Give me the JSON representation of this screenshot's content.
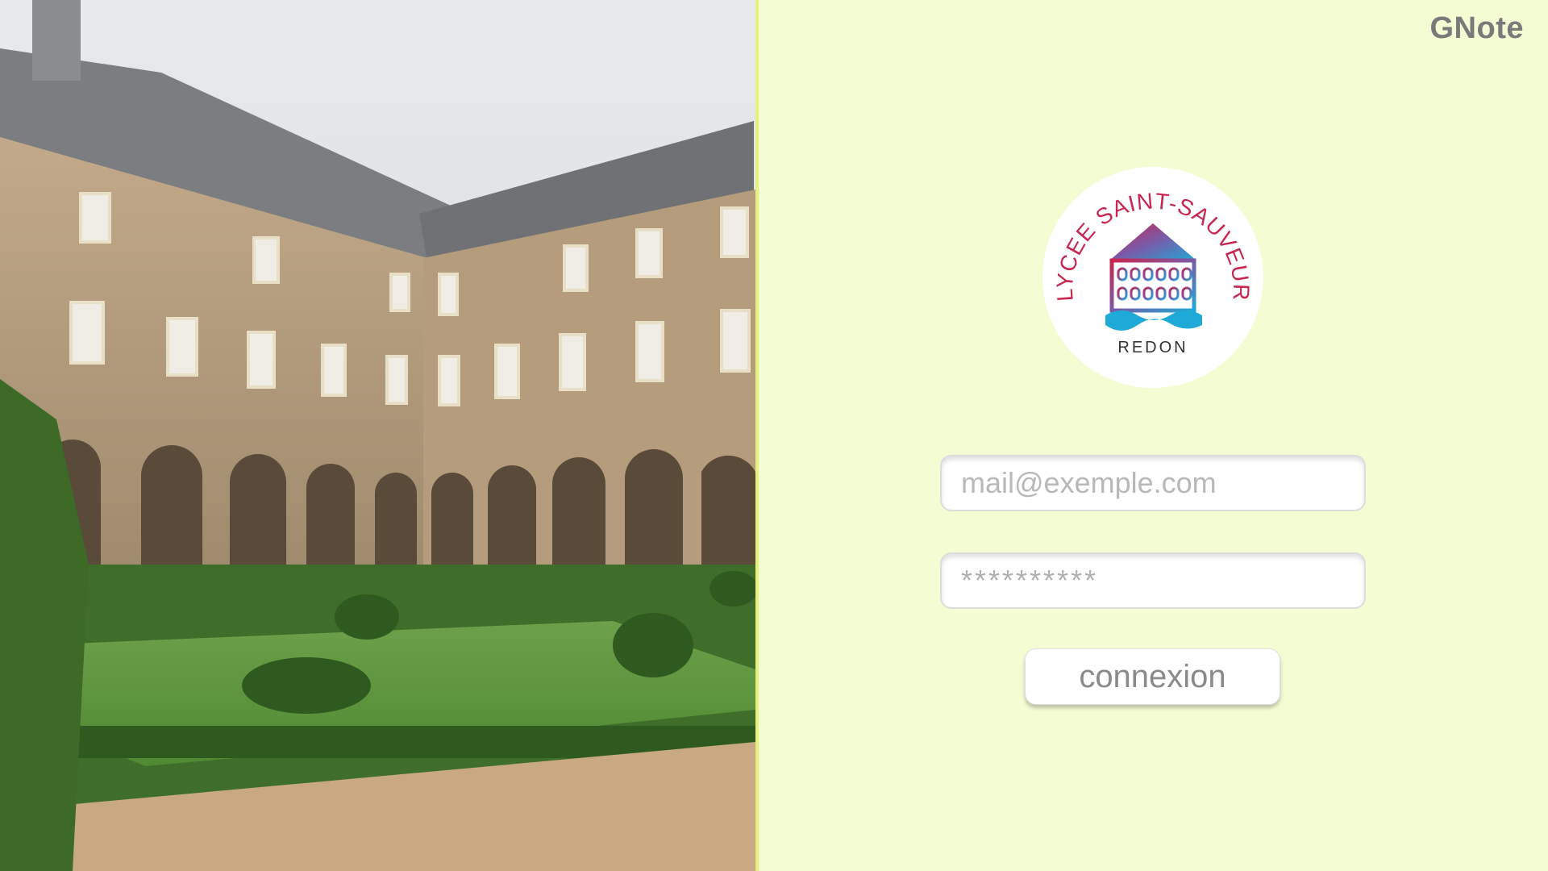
{
  "app": {
    "title": "GNote"
  },
  "photo": {
    "subject": "cloister-courtyard-photo"
  },
  "logo": {
    "arc_text": "LYCEE SAINT-SAUVEUR",
    "city": "REDON"
  },
  "login": {
    "email_placeholder": "mail@exemple.com",
    "password_placeholder": "**********",
    "submit_label": "connexion"
  },
  "colors": {
    "panel_background": "#f4fcd4",
    "divider": "#e6f27c",
    "title_text": "#7a7a7a",
    "logo_red": "#c8264e",
    "logo_blue": "#1fa9d6"
  }
}
